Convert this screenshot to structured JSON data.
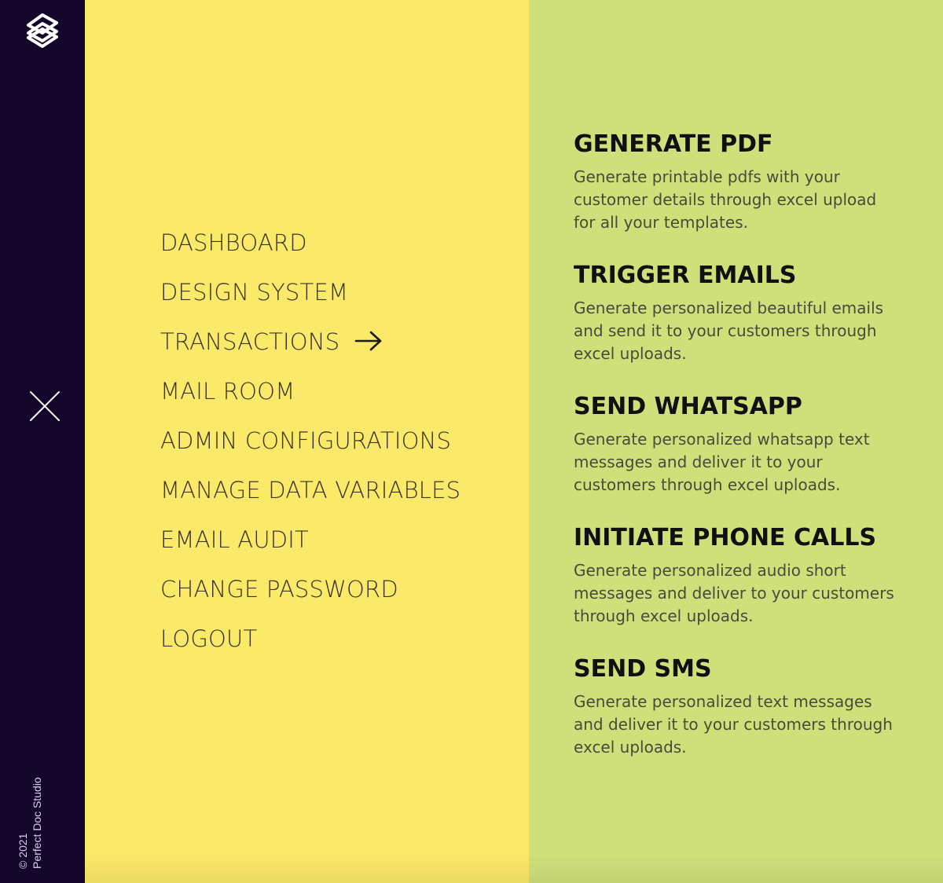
{
  "app": {
    "logo_icon": "layers-logo-icon",
    "copyright_year": "© 2021",
    "copyright_name": "Perfect Doc Studio"
  },
  "colors": {
    "rail": "#14052b",
    "nav_panel": "#fbe969",
    "feature_panel": "#cfe07b"
  },
  "rail": {
    "close_icon": "close-icon"
  },
  "nav": {
    "items": [
      {
        "label": "DASHBOARD"
      },
      {
        "label": "DESIGN SYSTEM"
      },
      {
        "label": "TRANSACTIONS",
        "active": true,
        "icon": "arrow-right-icon"
      },
      {
        "label": "MAIL ROOM"
      },
      {
        "label": "ADMIN CONFIGURATIONS"
      },
      {
        "label": "MANAGE DATA VARIABLES"
      },
      {
        "label": "EMAIL AUDIT"
      },
      {
        "label": "CHANGE PASSWORD"
      },
      {
        "label": "LOGOUT"
      }
    ]
  },
  "features": {
    "items": [
      {
        "title": "GENERATE PDF",
        "desc": "Generate printable pdfs with your customer details through excel upload for all your templates."
      },
      {
        "title": "TRIGGER EMAILS",
        "desc": "Generate personalized beautiful emails and send it to your customers through excel uploads."
      },
      {
        "title": "SEND WHATSAPP",
        "desc": "Generate personalized whatsapp text messages and deliver it to your customers through excel uploads."
      },
      {
        "title": "INITIATE PHONE CALLS",
        "desc": "Generate personalized audio short messages and deliver to your customers through excel uploads."
      },
      {
        "title": "SEND SMS",
        "desc": "Generate personalized text messages and deliver it to your customers through excel uploads."
      }
    ]
  }
}
